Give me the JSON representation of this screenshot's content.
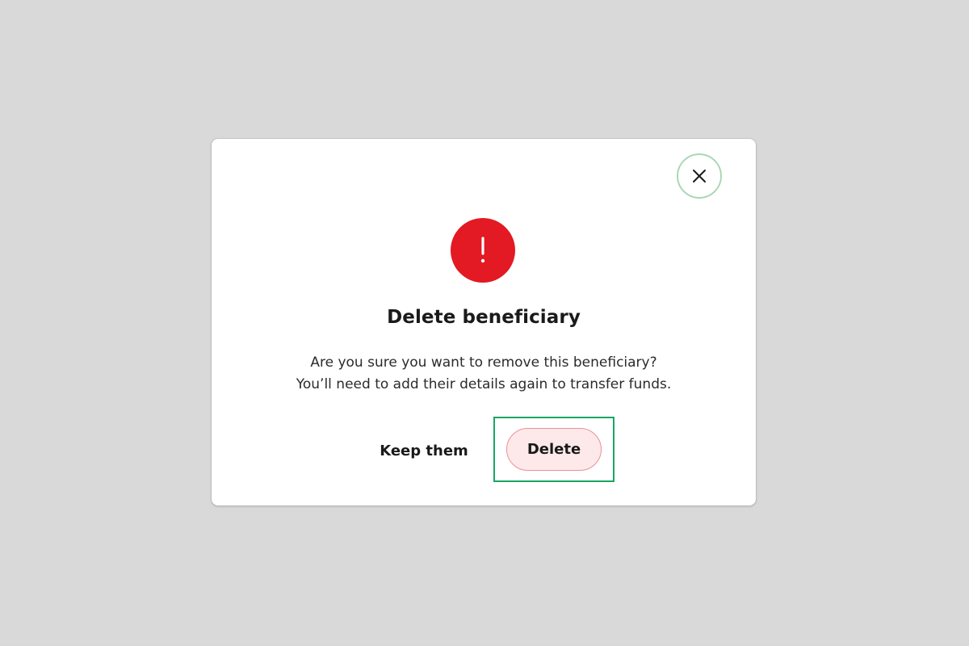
{
  "dialog": {
    "title": "Delete beneficiary",
    "message_line1": "Are you sure you want to remove this beneficiary?",
    "message_line2": "You’ll need to add their details again to transfer funds.",
    "alert_icon": "exclamation-icon",
    "close_icon": "close-icon",
    "actions": {
      "keep_label": "Keep them",
      "delete_label": "Delete"
    }
  },
  "colors": {
    "backdrop": "#d9d9d9",
    "alert_red": "#e31923",
    "delete_fill": "#fde9ea",
    "delete_border": "#ee8f94",
    "focus_ring": "#1aa564",
    "close_ring": "#a8d8b6"
  }
}
